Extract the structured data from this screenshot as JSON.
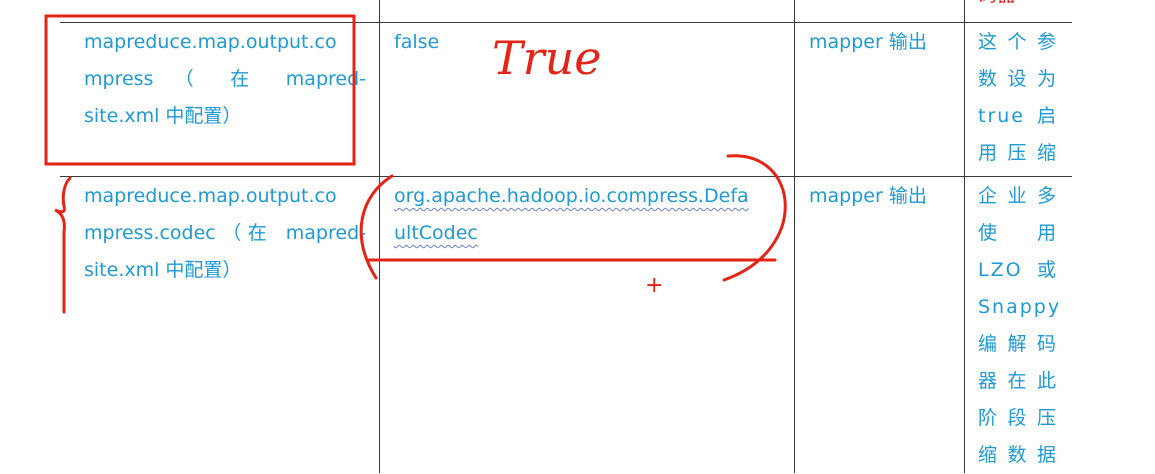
{
  "top_partial_text": "码器",
  "rows": [
    {
      "param_lines": [
        "mapreduce.map.output.co",
        "mpress （ 在 mapred-",
        "site.xml 中配置）"
      ],
      "default_lines": [
        "false"
      ],
      "stage": "mapper 输出",
      "note_lines": [
        "这个参",
        "数设为",
        "true 启",
        "用压缩"
      ]
    },
    {
      "param_lines": [
        "mapreduce.map.output.co",
        "mpress.codec（在 mapred-",
        "site.xml 中配置）"
      ],
      "default_lines": [
        "org.apache.hadoop.io.compress.Defa",
        "ultCodec"
      ],
      "stage": "mapper 输出",
      "note_lines": [
        "企业多",
        "使 用",
        "LZO 或",
        "Snappy",
        "编解码",
        "器在此",
        "阶段压",
        "缩数据"
      ]
    }
  ],
  "annotations": {
    "handwritten_text": "True",
    "plus_sign": "+",
    "ink_color": "#e32416"
  }
}
